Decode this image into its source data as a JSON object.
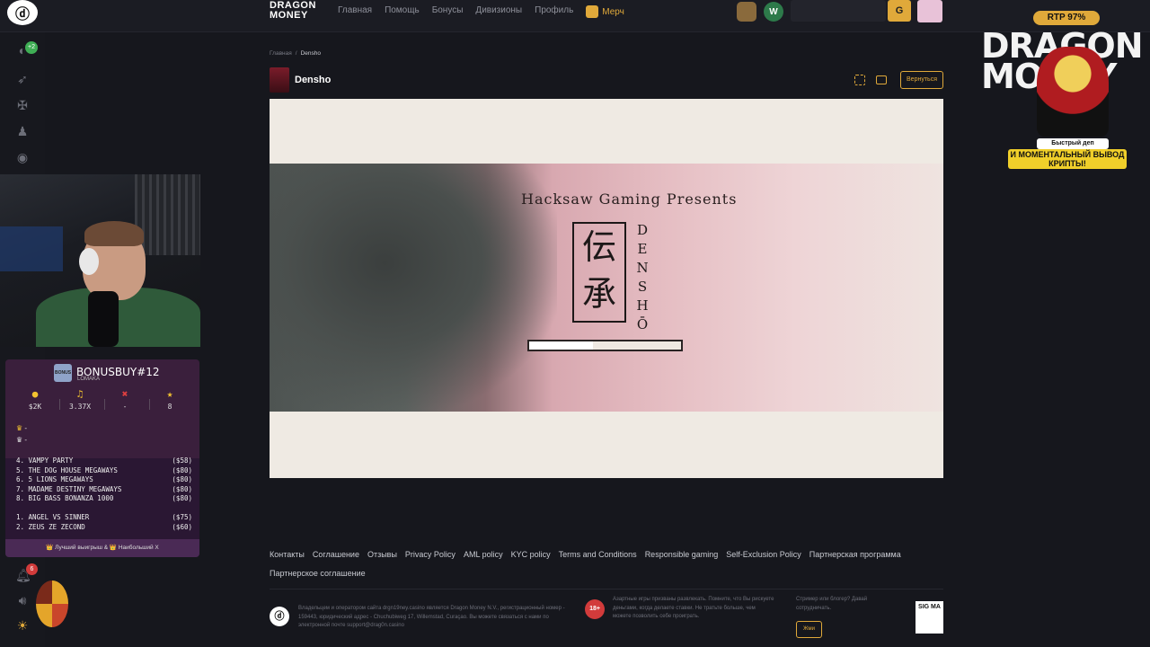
{
  "topbar": {
    "brand_line1": "DRAGON",
    "brand_line2": "MONEY",
    "nav": [
      "Главная",
      "Помощь",
      "Бонусы",
      "Дивизионы",
      "Профиль"
    ],
    "merch": "Мерч",
    "gold_icon": "G",
    "wallet_icon": "W"
  },
  "sidebar": {
    "badge": "+2",
    "notif_badge": "6"
  },
  "bonusbuy": {
    "title": "BONUSBUY#12",
    "subtitle": "LOMAKA",
    "box_label": "BONUS",
    "stats": [
      {
        "icon": "●",
        "value": "$2K",
        "color": "#f2c230"
      },
      {
        "icon": "♫",
        "value": "3.37X",
        "color": "#f2c230"
      },
      {
        "icon": "✖",
        "value": "-",
        "color": "#e04040"
      },
      {
        "icon": "★",
        "value": "8",
        "color": "#f2c230"
      }
    ],
    "crowns": [
      "-",
      "-"
    ],
    "list": [
      {
        "name": "4. VAMPY PARTY",
        "price": "($58)"
      },
      {
        "name": "5. THE DOG HOUSE MEGAWAYS",
        "price": "($80)"
      },
      {
        "name": "6. 5 LIONS MEGAWAYS",
        "price": "($80)"
      },
      {
        "name": "7. MADAME DESTINY MEGAWAYS",
        "price": "($80)"
      },
      {
        "name": "8. BIG BASS BONANZA 1000",
        "price": "($80)"
      },
      {
        "name": "",
        "price": ""
      },
      {
        "name": "1. ANGEL VS SINNER",
        "price": "($75)"
      },
      {
        "name": "2. ZEUS ZE ZECOND",
        "price": "($60)"
      }
    ],
    "footer": "👑 Лучший выигрыш & 👑 Наибольший X"
  },
  "main": {
    "breadcrumb_home": "Главная",
    "breadcrumb_sep": "/",
    "breadcrumb_current": "Densho",
    "game_title": "Densho",
    "back_button": "Вернуться"
  },
  "game": {
    "presents": "Hacksaw Gaming Presents",
    "kanji": "伝承",
    "densho_vertical": [
      "D",
      "E",
      "N",
      "S",
      "H",
      "Ō"
    ],
    "loading_progress": 0.42
  },
  "footer": {
    "links": [
      "Контакты",
      "Соглашение",
      "Отзывы",
      "Privacy Policy",
      "AML policy",
      "KYC policy",
      "Terms and Conditions",
      "Responsible gaming",
      "Self-Exclusion Policy",
      "Партнерская программа",
      "Партнерское соглашение"
    ],
    "owner_text": "Владельцем и оператором сайта drgn19ney.casino является Dragon Money N.V., регистрационный номер - 159443, юридический адрес - Chuchubiweg 17, Willemstad, Curaçao. Вы можете связаться с нами по электронной почте support@drag0n.casino",
    "age": "18+",
    "warning_text": "Азартные игры призваны развлекать. Помните, что Вы рискуете деньгами, когда делаете ставки. Не тратьте больше, чем можете позволить себе проиграть.",
    "partner_text": "Стример или блогер? Давай сотрудничать.",
    "partner_button": "Жми",
    "sigma": "SIG MA"
  },
  "promo": {
    "rtp": "RTP 97%",
    "big_text": "DRAGON MONEY",
    "tag1": "Быстрый деп",
    "tag2": "И МОМЕНТАЛЬНЫЙ ВЫВОД КРИПТЫ!"
  }
}
